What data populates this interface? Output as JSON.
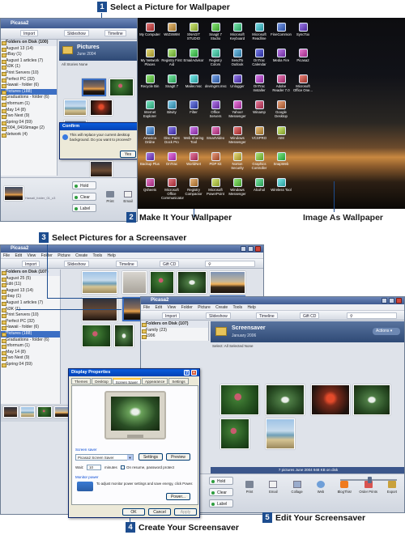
{
  "callouts": {
    "c1": {
      "num": "1",
      "text": "Select a Picture for Wallpaper"
    },
    "c2": {
      "num": "2",
      "text": "Make It Your Wallpaper"
    },
    "c3": {
      "num": "3",
      "text": "Select Pictures for a Screensaver"
    },
    "c4": {
      "num": "4",
      "text": "Create Your Screensaver"
    },
    "c5": {
      "num": "5",
      "text": "Edit Your Screensaver"
    },
    "image_as_wallpaper": "Image As Wallpaper"
  },
  "picasa1": {
    "title": "Picasa2",
    "toolbar": [
      "Import",
      "Slideshow",
      "Timeline"
    ],
    "sidebar_header": "Folders on Disk (100)",
    "folders": [
      "August 13 (14)",
      "eBay (1)",
      "August 1 articles (7)",
      "N3K (1)",
      "Print Servers (10)",
      "Perfect PC (32)",
      "Hawaii - folder (6)",
      "Pictures (188)",
      "Graduations - folder (6)",
      "Informum (1)",
      "May 14 (8)",
      "Two Next (9)",
      "Spring 04 (59)",
      "2004_0416image (2)",
      "Network (4)"
    ],
    "selected_folder": "Pictures (188)",
    "album_title": "Pictures",
    "album_date": "June 2004",
    "album_links": "All Stories  None",
    "caption": "Hawaii_folder_01_c3",
    "bottom_buttons": [
      "Hold",
      "Clear",
      "Label"
    ],
    "bottom_icons": [
      "Print",
      "Email"
    ],
    "confirm": {
      "title": "Confirm",
      "message": "This will replace your current desktop background. Do you want to proceed?",
      "yes": "Yes"
    }
  },
  "desktop_icons": [
    [
      "My Computer",
      "WIZSWIM",
      "SNAGIT STUDIO",
      "Snagit 7 Studio",
      "Microsoft Keyboard",
      "Microsoft Readline",
      "FineCommon",
      "SyncTox"
    ],
    [
      "My Network Places",
      "Registry First Aid",
      "EmailAdvisor",
      "Registry Colors",
      "SendTo Outlook",
      "OnTrac Calendar",
      "Media Fire",
      "Picasa2"
    ],
    [
      "Recycle Bin",
      "SnagIt 7",
      "Mailer.msc",
      "devmgmt.msc",
      "Unlogger",
      "OnTrac Installer",
      "Adobe Reader 7.0",
      "Microsoft Office One..."
    ],
    [
      "Internet Explorer",
      "Bitvity",
      "Filter",
      "Office Servers",
      "Yahoo! Messenger",
      "Winamp",
      "Google Desktop",
      ""
    ],
    [
      "America Online",
      "Disc Paint Dock Pro",
      "Web Sharing Tool",
      "SmartVideo",
      "Windows Messenger",
      "VCSPRO",
      "AIM",
      ""
    ],
    [
      "Backup Plus",
      "OnTrac",
      "WorldNet",
      "PDP Kit",
      "Norton Security",
      "Graphics Controller",
      "SnapWeb",
      ""
    ],
    [
      "Qsheets",
      "Microsoft Office Communicator",
      "Registry Compactor",
      "Microsoft PowerPoint",
      "Windows Messenger",
      "Alcohol",
      "Wireless Tool",
      ""
    ]
  ],
  "picasa2": {
    "title": "Picasa2",
    "menus": [
      "File",
      "Edit",
      "View",
      "Folder",
      "Picture",
      "Create",
      "Tools",
      "Help"
    ],
    "toolbar": [
      "Import",
      "Slideshow",
      "Timeline",
      "Gift CD"
    ],
    "sidebar_header": "Folders on Disk (107)",
    "folders": [
      "August 25 (5)",
      "Edit (11)",
      "August 13 (14)",
      "ebay (1)",
      "August 1 articles (7)",
      "N3K (1)",
      "Print Servers (10)",
      "Perfect PC (32)",
      "Hawaii - folder (6)",
      "Pictures (188)",
      "Graduations - folder (6)",
      "Informum (1)",
      "May 14 (8)",
      "Two Next (9)",
      "Spring 04 (59)"
    ],
    "selected_folder": "Pictures (188)"
  },
  "picasa3": {
    "title": "Picasa2",
    "menus": [
      "File",
      "Edit",
      "View",
      "Folder",
      "Picture",
      "Create",
      "Tools",
      "Help"
    ],
    "toolbar": [
      "Import",
      "Slideshow",
      "Timeline",
      "Gift CD"
    ],
    "sidebar_header": "Folders on Disk (107)",
    "folders": [
      "Family (23)",
      "1996"
    ],
    "album_title": "Screensaver",
    "album_date": "January 2006",
    "album_links": "Select: All Selected None",
    "actions": "Actions",
    "status": "7 pictures  June 2004  948 KB on disk",
    "bottom_buttons": [
      "Hold",
      "Clear",
      "Label"
    ],
    "bottom_icons": [
      "Print",
      "Email",
      "Collage",
      "Web",
      "BlogThis!",
      "Order Prints",
      "Export"
    ]
  },
  "display_props": {
    "title": "Display Properties",
    "tabs": [
      "Themes",
      "Desktop",
      "Screen Saver",
      "Appearance",
      "Settings"
    ],
    "active_tab": "Screen Saver",
    "group_label": "Screen saver",
    "select_value": "Picasa2 Screen Saver",
    "settings": "Settings",
    "preview": "Preview",
    "wait_label": "Wait:",
    "wait_value": "10",
    "minutes": "minutes",
    "resume": "On resume, password protect",
    "monitor_label": "Monitor power",
    "monitor_text": "To adjust monitor power settings and save energy, click Power.",
    "power": "Power...",
    "ok": "OK",
    "cancel": "Cancel",
    "apply": "Apply"
  }
}
